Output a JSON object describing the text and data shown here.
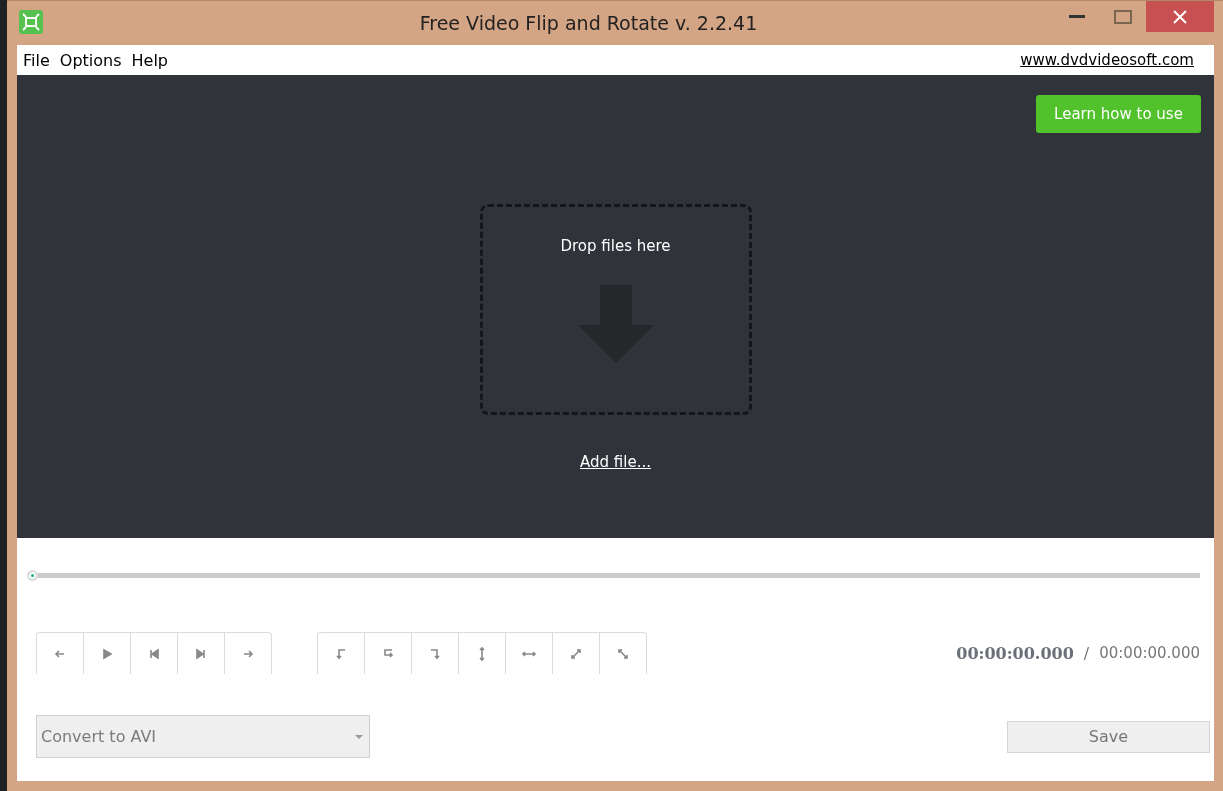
{
  "window": {
    "title": "Free Video Flip and Rotate v. 2.2.41"
  },
  "menu": [
    "File",
    "Options",
    "Help"
  ],
  "website_link": "www.dvdvideosoft.com",
  "learn_button": "Learn how to use",
  "drop_zone": {
    "label": "Drop files here",
    "add_link": "Add file..."
  },
  "timeline": {
    "level": 0
  },
  "playback_buttons": [
    {
      "kind": "step-back"
    },
    {
      "kind": "play"
    },
    {
      "kind": "go-start"
    },
    {
      "kind": "go-end"
    },
    {
      "kind": "step-forward"
    }
  ],
  "transform_buttons": [
    {
      "kind": "rotate-left"
    },
    {
      "kind": "rotate-180"
    },
    {
      "kind": "rotate-right"
    },
    {
      "kind": "flip-vertical"
    },
    {
      "kind": "flip-horizontal"
    },
    {
      "kind": "diagonal-up"
    },
    {
      "kind": "diagonal-down"
    }
  ],
  "time": {
    "current": "00:00:00.000",
    "separator": "/",
    "total": "00:00:00.000"
  },
  "format_select": {
    "value": "Convert to AVI",
    "disabled": true
  },
  "save_button": {
    "label": "Save",
    "disabled": true
  }
}
